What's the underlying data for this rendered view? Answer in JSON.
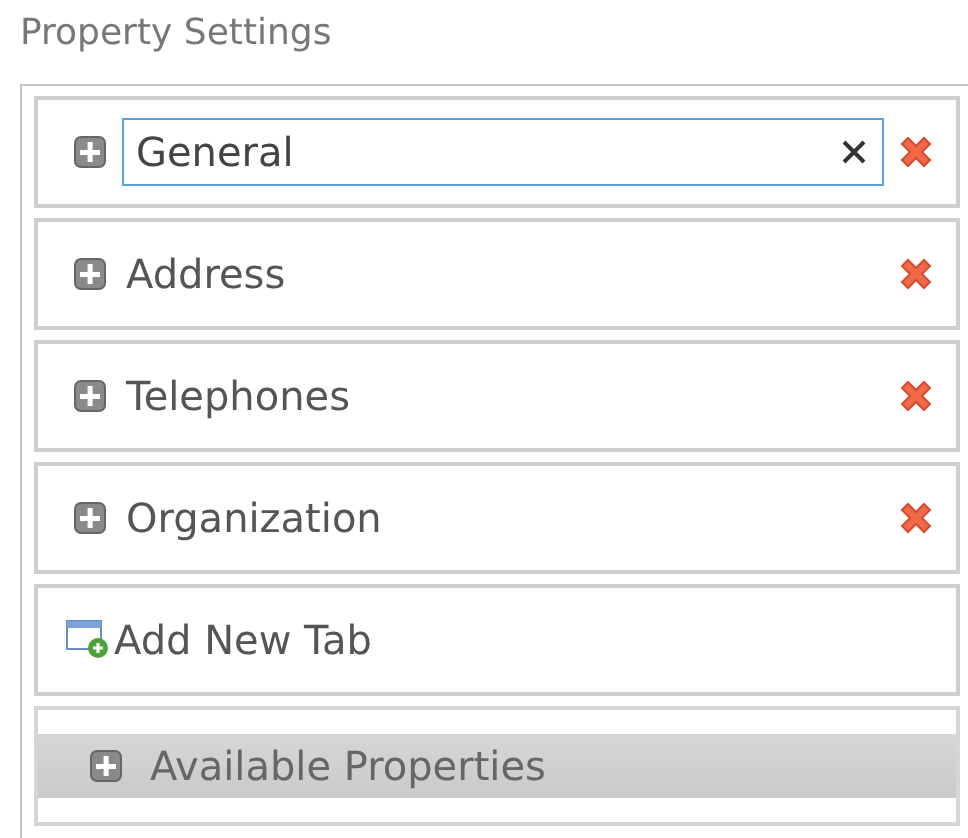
{
  "title": "Property Settings",
  "tabs": [
    {
      "label": "General",
      "editing": true
    },
    {
      "label": "Address",
      "editing": false
    },
    {
      "label": "Telephones",
      "editing": false
    },
    {
      "label": "Organization",
      "editing": false
    }
  ],
  "add_button": "Add New Tab",
  "available": {
    "label": "Available Properties",
    "expanded": false
  }
}
